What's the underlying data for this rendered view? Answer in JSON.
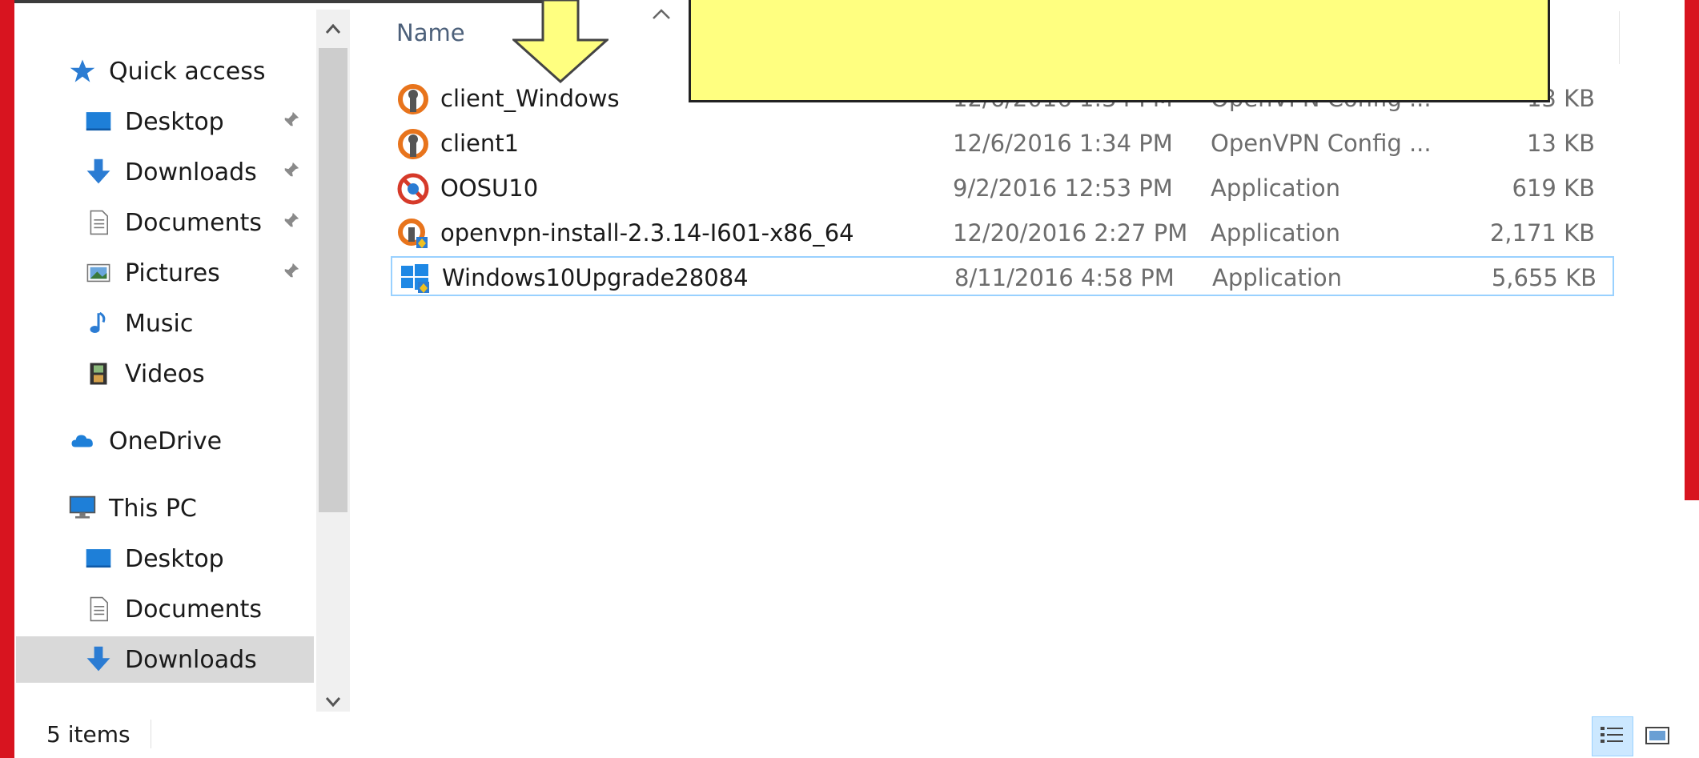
{
  "nav": {
    "items": [
      {
        "label": "Quick access",
        "icon": "star-icon",
        "level": 0,
        "pinned": false
      },
      {
        "label": "Desktop",
        "icon": "desktop-icon",
        "level": 1,
        "pinned": true
      },
      {
        "label": "Downloads",
        "icon": "download-arrow-icon",
        "level": 1,
        "pinned": true
      },
      {
        "label": "Documents",
        "icon": "document-icon",
        "level": 1,
        "pinned": true
      },
      {
        "label": "Pictures",
        "icon": "pictures-icon",
        "level": 1,
        "pinned": true
      },
      {
        "label": "Music",
        "icon": "music-note-icon",
        "level": 1,
        "pinned": false
      },
      {
        "label": "Videos",
        "icon": "film-icon",
        "level": 1,
        "pinned": false
      },
      {
        "label": "OneDrive",
        "icon": "cloud-icon",
        "level": 0,
        "pinned": false
      },
      {
        "label": "This PC",
        "icon": "computer-icon",
        "level": 0,
        "pinned": false
      },
      {
        "label": "Desktop",
        "icon": "desktop-icon",
        "level": 1,
        "pinned": false
      },
      {
        "label": "Documents",
        "icon": "document-icon",
        "level": 1,
        "pinned": false
      },
      {
        "label": "Downloads",
        "icon": "download-arrow-icon",
        "level": 1,
        "pinned": false,
        "selected": true
      }
    ]
  },
  "list": {
    "column_name": "Name",
    "files": [
      {
        "name": "client_Windows",
        "date": "12/6/2016 1:34 PM",
        "type": "OpenVPN Config ...",
        "size": "13 KB",
        "icon": "openvpn-icon"
      },
      {
        "name": "client1",
        "date": "12/6/2016 1:34 PM",
        "type": "OpenVPN Config ...",
        "size": "13 KB",
        "icon": "openvpn-icon"
      },
      {
        "name": "OOSU10",
        "date": "9/2/2016 12:53 PM",
        "type": "Application",
        "size": "619 KB",
        "icon": "oosu-icon"
      },
      {
        "name": "openvpn-install-2.3.14-I601-x86_64",
        "date": "12/20/2016 2:27 PM",
        "type": "Application",
        "size": "2,171 KB",
        "icon": "openvpn-installer-icon"
      },
      {
        "name": "Windows10Upgrade28084",
        "date": "8/11/2016 4:58 PM",
        "type": "Application",
        "size": "5,655 KB",
        "icon": "windows-upgrade-icon",
        "selected": true
      }
    ]
  },
  "status": {
    "item_count": "5 items"
  },
  "colors": {
    "accent_selection": "#99d1ff",
    "callout": "#ffff80",
    "nav_selected": "#d9d9d9"
  }
}
